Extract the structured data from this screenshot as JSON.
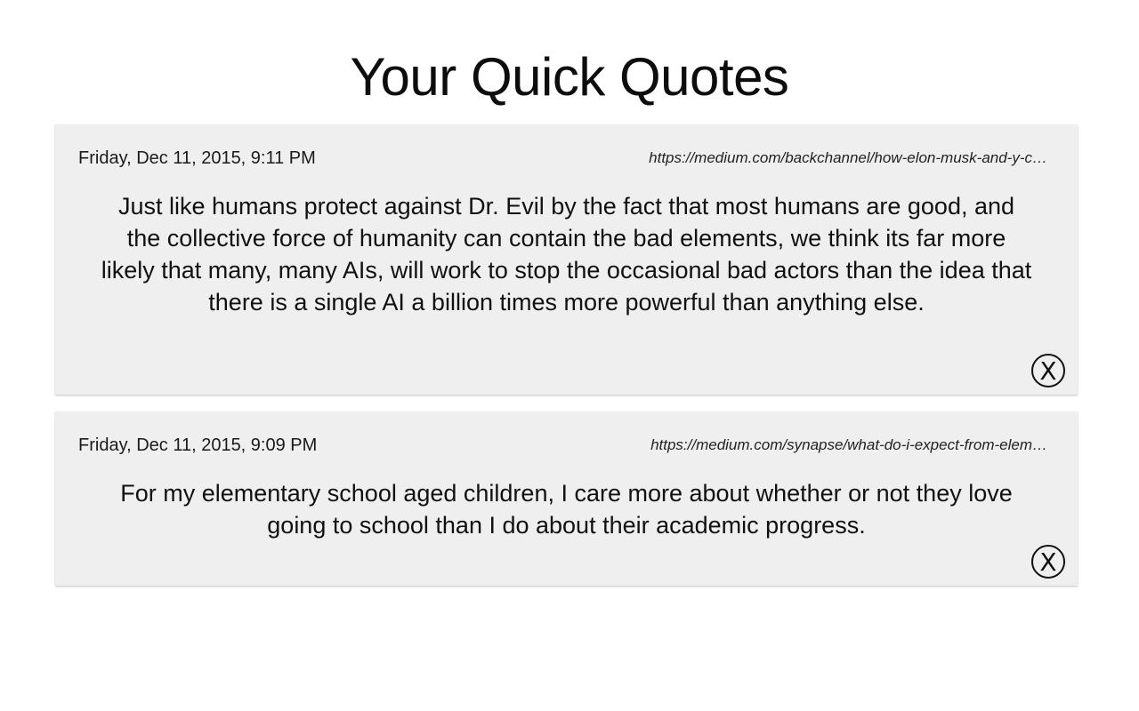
{
  "page": {
    "title": "Your Quick Quotes"
  },
  "quotes": [
    {
      "date": "Friday, Dec 11, 2015, 9:11 PM",
      "url": "https://medium.com/backchannel/how-elon-musk-and-y-c…",
      "text": "Just like humans protect against Dr. Evil by the fact that most humans are good, and the collective force of humanity can contain the bad elements, we think its far more likely that many, many AIs, will work to stop the occasional bad actors than the idea that there is a single AI a billion times more powerful than anything else.",
      "close_label": "X",
      "close_icon": "close-circle-icon"
    },
    {
      "date": "Friday, Dec 11, 2015, 9:09 PM",
      "url": "https://medium.com/synapse/what-do-i-expect-from-elem…",
      "text": "For my elementary school aged children, I care more about whether or not they love going to school than I do about their academic progress.",
      "close_label": "X",
      "close_icon": "close-circle-icon"
    }
  ],
  "colors": {
    "background": "#ffffff",
    "card_background": "#efefef",
    "text": "#111111"
  }
}
